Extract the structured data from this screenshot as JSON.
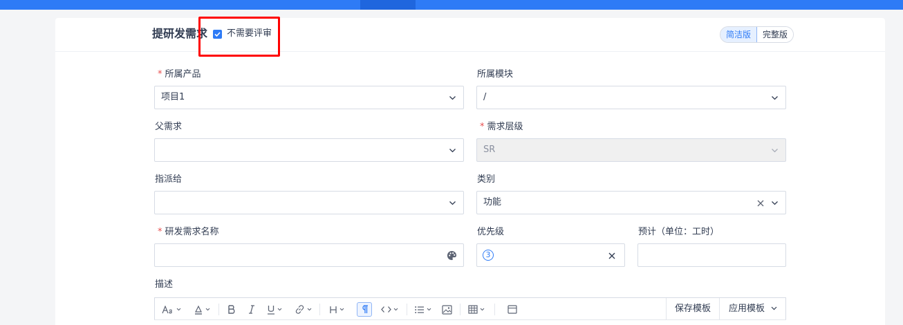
{
  "header": {
    "title": "提研发需求",
    "no_review_label": "不需要评审",
    "no_review_checked": true,
    "version_simple": "简洁版",
    "version_full": "完整版"
  },
  "form": {
    "product": {
      "label": "所属产品",
      "required": true,
      "value": "项目1"
    },
    "module": {
      "label": "所属模块",
      "required": false,
      "value": "/"
    },
    "parent": {
      "label": "父需求",
      "required": false,
      "value": ""
    },
    "level": {
      "label": "需求层级",
      "required": true,
      "value": "SR"
    },
    "assignee": {
      "label": "指派给",
      "required": false,
      "value": ""
    },
    "category": {
      "label": "类别",
      "required": false,
      "value": "功能"
    },
    "name": {
      "label": "研发需求名称",
      "required": true,
      "value": ""
    },
    "priority": {
      "label": "优先级",
      "value": "3"
    },
    "estimate": {
      "label": "预计（单位：工时）",
      "value": ""
    },
    "description": {
      "label": "描述"
    }
  },
  "editor": {
    "save_template": "保存模板",
    "apply_template": "应用模板",
    "tools": [
      "font-size-icon",
      "color-icon",
      "bold-icon",
      "italic-icon",
      "underline-icon",
      "link-icon",
      "heading-icon",
      "paragraph-icon",
      "code-icon",
      "list-icon",
      "image-icon",
      "table-icon",
      "layout-icon"
    ]
  },
  "colors": {
    "accent": "#2e7bf6",
    "required": "#e84f4f",
    "highlight": "#ff0000"
  }
}
